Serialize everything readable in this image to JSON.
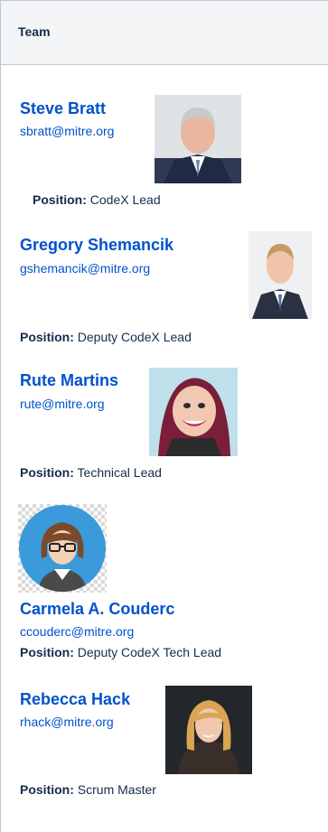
{
  "table": {
    "header": "Team"
  },
  "position_label": "Position:",
  "members": [
    {
      "name": "Steve Bratt",
      "email": "sbratt@mitre.org",
      "position": "CodeX Lead",
      "photo": "man-gray-hair-suit-photo"
    },
    {
      "name": "Gregory Shemancik",
      "email": "gshemancik@mitre.org",
      "position": "Deputy CodeX Lead",
      "photo": "young-man-suit-photo"
    },
    {
      "name": "Rute Martins",
      "email": "rute@mitre.org",
      "position": "Technical Lead",
      "photo": "caricature-woman-photo"
    },
    {
      "name": "Carmela A. Couderc",
      "email": "ccouderc@mitre.org",
      "position": "Deputy CodeX Tech Lead",
      "photo": "avatar-woman-glasses-icon"
    },
    {
      "name": "Rebecca Hack",
      "email": "rhack@mitre.org",
      "position": "Scrum Master",
      "photo": "woman-blonde-photo"
    }
  ]
}
